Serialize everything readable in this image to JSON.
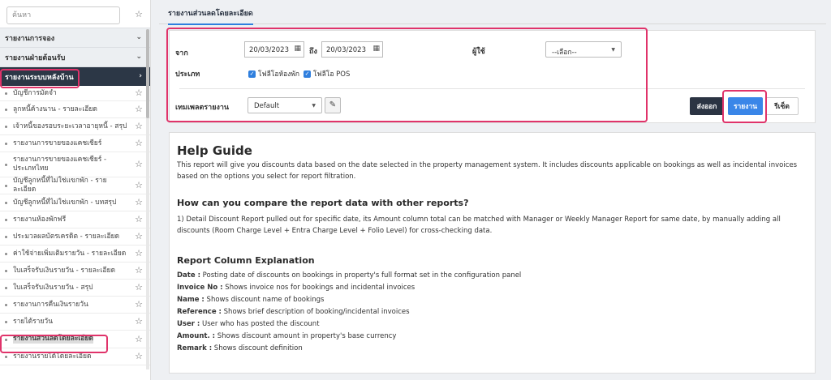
{
  "search": {
    "placeholder": "ค้นหา"
  },
  "sections": {
    "booking": "รายงานการจอง",
    "front_office": "รายงานฝ่ายต้อนรับ",
    "back_office": "รายงานระบบหลังบ้าน"
  },
  "menu": [
    "บัญชีการมัดจำ",
    "ลูกหนี้ค้างนาน - รายละเอียด",
    "เจ้าหนี้ของรอบระยะเวลาอายุหนี้ - สรุป",
    "รายงานการขายของแคชเชียร์",
    "รายงานการขายของแคชเชียร์ - ประเภทไทย",
    "บัญชีลูกหนี้ที่ไม่ใช่แขกพัก - รายละเอียด",
    "บัญชีลูกหนี้ที่ไม่ใช่แขกพัก - บทสรุป",
    "รายงานห้องพักฟรี",
    "ประมวลผลบัตรเครดิต - รายละเอียด",
    "ค่าใช้จ่ายเพิ่มเติมรายวัน - รายละเอียด",
    "ใบเสร็จรับเงินรายวัน - รายละเอียด",
    "ใบเสร็จรับเงินรายวัน - สรุป",
    "รายงานการคืนเงินรายวัน",
    "รายได้รายวัน",
    "รายงานส่วนลดโดยละเอียด",
    "รายงานรายได้โดยละเอียด"
  ],
  "tab": {
    "label": "รายงานส่วนลดโดยละเอียด"
  },
  "filters": {
    "from_label": "จาก",
    "from_value": "20/03/2023",
    "to_label": "ถึง",
    "to_value": "20/03/2023",
    "user_label": "ผู้ใช้",
    "user_value": "--เลือก--",
    "type_label": "ประเภท",
    "type_room_folio": "โฟลีโอห้องพัก",
    "type_pos_folio": "โฟลีโอ POS",
    "template_label": "เทมเพลตรายงาน",
    "template_value": "Default"
  },
  "buttons": {
    "export": "ส่งออก",
    "report": "รายงาน",
    "reset": "รีเซ็ต"
  },
  "help": {
    "title": "Help Guide",
    "intro": "This report will give you discounts data based on the date selected in the property management system. It includes discounts applicable on bookings as well as incidental invoices based on the options you select for report filtration.",
    "compare_title": "How can you compare the report data with other reports?",
    "compare_text": "1) Detail Discount Report pulled out for specific date, its Amount column total can be matched with Manager or Weekly Manager Report for same date, by manually adding all discounts (Room Charge Level + Entra Charge Level + Folio Level) for cross-checking data.",
    "columns_title": "Report Column Explanation",
    "columns": [
      {
        "name": "Date :",
        "desc": " Posting date of discounts on bookings in property's full format set in the configuration panel"
      },
      {
        "name": "Invoice No :",
        "desc": " Shows invoice nos for bookings and incidental invoices"
      },
      {
        "name": "Name :",
        "desc": " Shows discount name of bookings"
      },
      {
        "name": "Reference :",
        "desc": " Shows brief description of booking/incidental invoices"
      },
      {
        "name": "User :",
        "desc": " User who has posted the discount"
      },
      {
        "name": "Amount. :",
        "desc": " Shows discount amount in property's base currency"
      },
      {
        "name": "Remark :",
        "desc": " Shows discount definition"
      }
    ]
  },
  "colors": {
    "accent": "#3a86e8",
    "highlight": "#e0336a",
    "dark": "#2c3746"
  },
  "icons": {
    "star": "star-icon",
    "calendar": "calendar-icon",
    "edit": "edit-icon",
    "chevron": "chevron-icon"
  }
}
